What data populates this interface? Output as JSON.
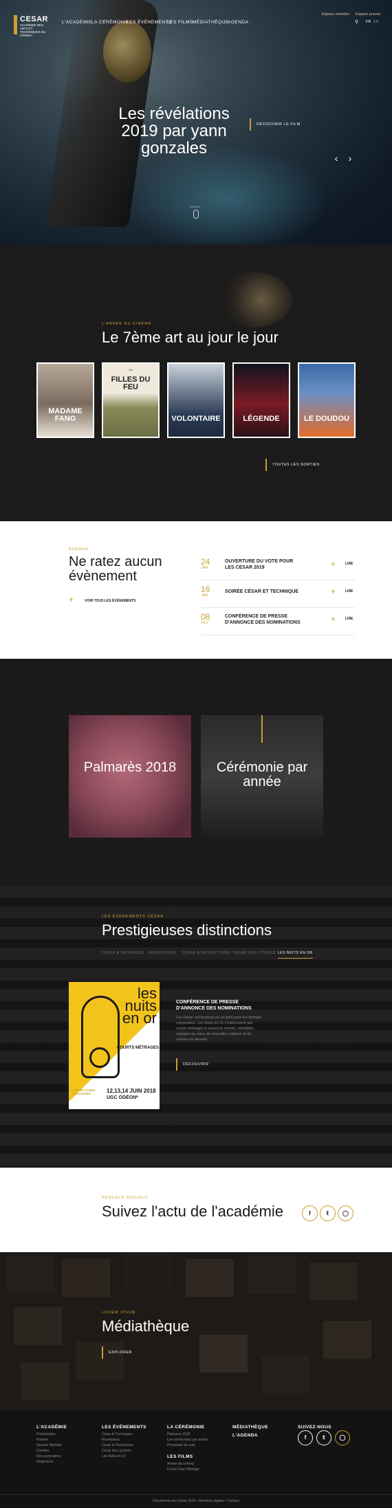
{
  "header": {
    "logo": {
      "line1": "CESAR",
      "line2": "ACADÉMIE DES ARTS ET TECHNIQUES DU CINÉMA"
    },
    "nav": [
      "L'ACADÉMIE",
      "LA CÉRÉMONIE",
      "LES ÉVÉNEMENTS",
      "LES FILMS",
      "MÉDIATHÈQUE",
      "AGENDA"
    ],
    "espace_membre": "Espace membre",
    "espace_presse": "Espace presse",
    "lang_fr": "FR",
    "lang_en": "EN"
  },
  "hero": {
    "title": "Les révélations 2019 par yann gonzales",
    "cta": "DÉCOUVRIR LE FILM",
    "scroll_label": "SCROLL"
  },
  "annee": {
    "eyebrow": "L'ANNÉE DU CINÉMA",
    "title": "Le 7ème art au jour le jour",
    "posters": [
      {
        "title": "MADAME FANG",
        "tag": ""
      },
      {
        "title": "FILLES DU FEU",
        "tag": "Les"
      },
      {
        "title": "VOLONTAIRE",
        "tag": ""
      },
      {
        "title": "LÉGENDE",
        "tag": ""
      },
      {
        "title": "LE DOUDOU",
        "tag": ""
      }
    ],
    "cta": "TOUTES LES SORTIES"
  },
  "agenda": {
    "eyebrow": "AGENDA",
    "title_line1": "Ne ratez aucun",
    "title_line2": "évènement",
    "voir_tous": "VOIR TOUS LES ÉVÉNEMENTS",
    "events": [
      {
        "day": "24",
        "month": "JAN",
        "title": "OUVERTURE DU VOTE POUR LES CESAR 2019",
        "action": "LIRE"
      },
      {
        "day": "16",
        "month": "JAN",
        "title": "SOIRÉE CÉSAR ET TECHNIQUE",
        "action": "LIRE"
      },
      {
        "day": "08",
        "month": "FÉV",
        "title": "CONFÉRENCE DE PRESSE D'ANNONCE DES NOMINATIONS",
        "action": "LIRE"
      }
    ]
  },
  "palmares": {
    "card1": "Palmarès 2018",
    "card2": "Cérémonie par année"
  },
  "distinctions": {
    "eyebrow": "LES ÉVÉNEMENTS CÉSAR",
    "title": "Prestigieuses distinctions",
    "tabs": [
      "CÉSAR & TECHNIQUE",
      "RÉVÉLATIONS",
      "CÉSAR & PRODUCTIONS",
      "CÉSAR DES LYCÉENS",
      "LES NUITS EN OR"
    ],
    "active_tab": 4,
    "flyer": {
      "title": "les nuits en or",
      "sub": "COURTS MÉTRAGES",
      "dates": "12,13,14 JUIN 2018",
      "venue": "UGC ODÉON*",
      "label": "PROJECTIONS GRATUITES"
    },
    "article_title": "CONFÉRENCE DE PRESSE D'ANNONCE DES NOMINATIONS",
    "article_body": "Les César ont toujours eu un goût pour les formats composites. Les Nuits en Or s'intéressent aux courts métrages à travers le monde, véritables voyages au cœur de nouvelles cultures et du cinéma de demain.",
    "cta": "DÉCOUVRIR"
  },
  "social": {
    "eyebrow": "RÉSEAUX SOCIAUX",
    "title": "Suivez l'actu de l'académie",
    "icons": [
      "facebook-icon",
      "twitter-icon",
      "instagram-icon"
    ]
  },
  "mediatheque": {
    "eyebrow": "LOREM IPSUM",
    "title": "Médiathèque",
    "cta": "EXPLORER"
  },
  "footer": {
    "col1": {
      "title": "L'ACADÉMIE",
      "links": [
        "Présentation",
        "Histoire",
        "Devenir Membre",
        "Comités",
        "Nos partenaires",
        "Règlement"
      ]
    },
    "col2": {
      "title": "LES ÉVÉNEMENTS",
      "links": [
        "César & Techniques",
        "Révélations",
        "César & Productions",
        "César des Lycéens",
        "Les Nuits en Or"
      ]
    },
    "col3": {
      "title": "LA CÉRÉMONIE",
      "links": [
        "Palmarès 2018",
        "Les cérémonies par année",
        "Procédure de vote"
      ],
      "title2": "LES FILMS",
      "links2": [
        "Année du cinéma",
        "Focus Court Métrage"
      ]
    },
    "col4": {
      "title": "MÉDIATHÈQUE",
      "title2": "L'AGENDA"
    },
    "col5": {
      "title": "SUIVEZ-NOUS"
    },
    "bottom": "©Académie des César 2019  •  Mentions légales  •  Contact"
  }
}
